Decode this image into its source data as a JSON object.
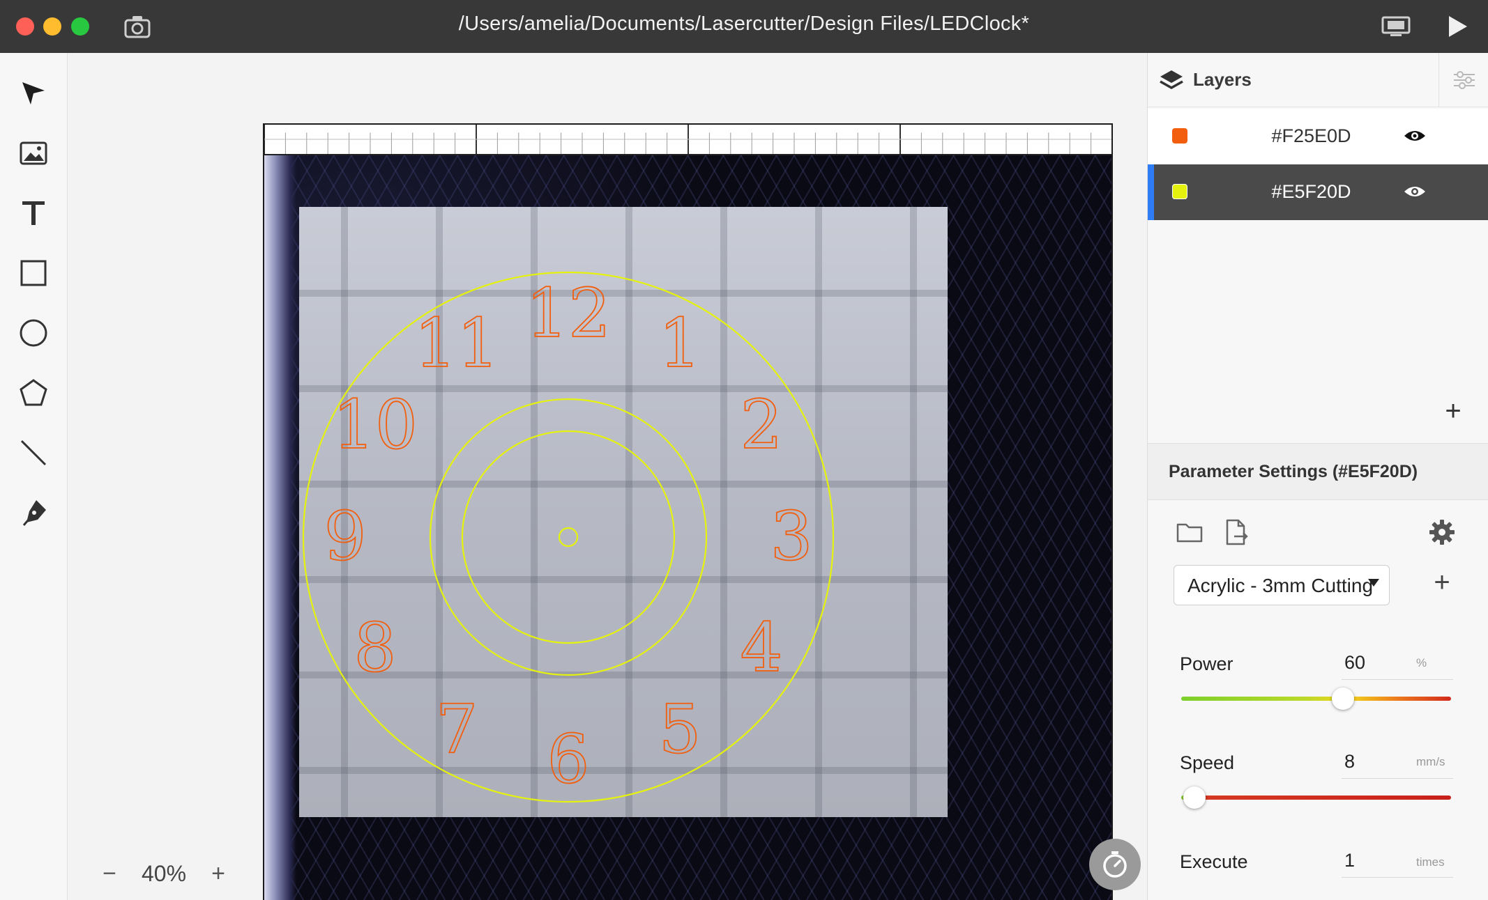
{
  "window": {
    "title": "/Users/amelia/Documents/Lasercutter/Design Files/LEDClock*"
  },
  "toolbar": {
    "tools": [
      "select-tool",
      "image-tool",
      "text-tool",
      "rectangle-tool",
      "ellipse-tool",
      "polygon-tool",
      "line-tool",
      "pen-tool"
    ]
  },
  "canvas": {
    "zoom_label": "40%",
    "zoom_out": "−",
    "zoom_in": "+",
    "clock_numerals": [
      "12",
      "1",
      "2",
      "3",
      "4",
      "5",
      "6",
      "7",
      "8",
      "9",
      "10",
      "11"
    ]
  },
  "layers": {
    "title": "Layers",
    "items": [
      {
        "name": "#F25E0D",
        "color": "#F25E0D",
        "selected": false
      },
      {
        "name": "#E5F20D",
        "color": "#E5F20D",
        "selected": true
      }
    ],
    "add_label": "+"
  },
  "parameters": {
    "title": "Parameter Settings (#E5F20D)",
    "preset": "Acrylic - 3mm Cutting",
    "preset_add": "+",
    "power": {
      "label": "Power",
      "value": "60",
      "unit": "%",
      "fraction": 0.6
    },
    "speed": {
      "label": "Speed",
      "value": "8",
      "unit": "mm/s",
      "fraction": 0.05
    },
    "execute": {
      "label": "Execute",
      "value": "1",
      "unit": "times"
    }
  },
  "colors": {
    "cut_layer_orange": "#F25E0D",
    "cut_layer_yellow": "#E5F20D",
    "selection_accent": "#2F7DF6"
  }
}
